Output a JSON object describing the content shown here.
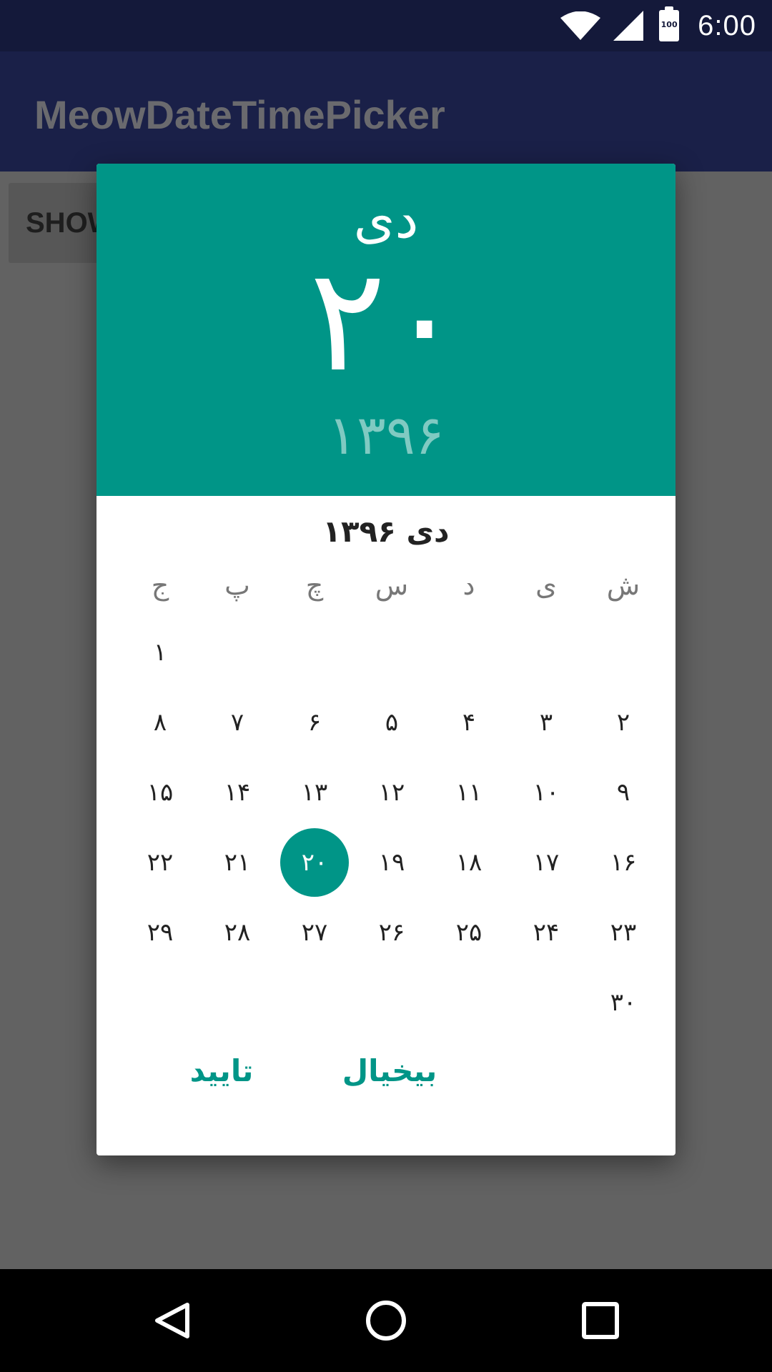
{
  "status_bar": {
    "time": "6:00",
    "battery_level": "100",
    "icons": [
      "wifi-icon",
      "cell-signal-icon",
      "battery-icon"
    ],
    "background": "#14193a"
  },
  "app_bar": {
    "title": "MeowDateTimePicker",
    "background": "#1a2048"
  },
  "content": {
    "show_button_label": "SHOW"
  },
  "dialog": {
    "accent_color": "#009587",
    "header": {
      "month": "دی",
      "day": "۲۰",
      "year": "۱۳۹۶"
    },
    "month_title": "دی ۱۳۹۶",
    "weekdays": [
      "ش",
      "ی",
      "د",
      "س",
      "چ",
      "پ",
      "ج"
    ],
    "leading_blank_days": 6,
    "days": [
      "۱",
      "۲",
      "۳",
      "۴",
      "۵",
      "۶",
      "۷",
      "۸",
      "۹",
      "۱۰",
      "۱۱",
      "۱۲",
      "۱۳",
      "۱۴",
      "۱۵",
      "۱۶",
      "۱۷",
      "۱۸",
      "۱۹",
      "۲۰",
      "۲۱",
      "۲۲",
      "۲۳",
      "۲۴",
      "۲۵",
      "۲۶",
      "۲۷",
      "۲۸",
      "۲۹",
      "۳۰"
    ],
    "selected_day": "۲۰",
    "buttons": {
      "ok": "تایید",
      "cancel": "بیخیال"
    }
  },
  "nav_bar": {
    "icons": [
      "back-icon",
      "home-icon",
      "recents-icon"
    ]
  }
}
